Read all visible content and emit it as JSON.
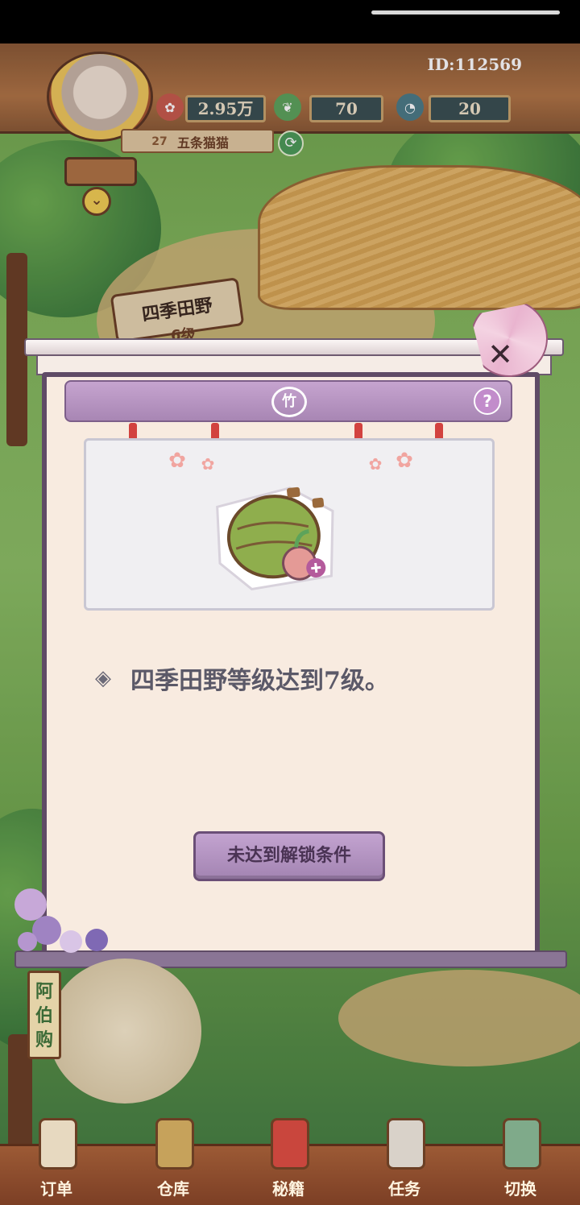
{
  "hud": {
    "user_id": "ID:112569",
    "stats": [
      {
        "name": "coins",
        "value": "2.95万",
        "icon": "coin-icon",
        "color": "#c85a4a"
      },
      {
        "name": "leaves",
        "value": "70",
        "icon": "leaf-icon",
        "color": "#5da35a"
      },
      {
        "name": "stamina",
        "value": "20",
        "icon": "stamina-icon",
        "color": "#4c7c86"
      }
    ],
    "player": {
      "level": "27",
      "name": "五条猫猫"
    }
  },
  "scene": {
    "field_sign": "四季田野",
    "field_sign_level": "6级"
  },
  "modal": {
    "header_icon": "竹",
    "help_label": "?",
    "close_label": "✕",
    "condition_text": "四季田野等级达到7级。",
    "unlock_button_label": "未达到解锁条件"
  },
  "shop_sign": "阿伯购",
  "bottom_nav": [
    {
      "label": "订单",
      "icon": "order-icon",
      "color": "#e7d9c0"
    },
    {
      "label": "仓库",
      "icon": "warehouse-icon",
      "color": "#c6a25b"
    },
    {
      "label": "秘籍",
      "icon": "book-icon",
      "color": "#c9463d"
    },
    {
      "label": "任务",
      "icon": "task-icon",
      "color": "#d9d2c9"
    },
    {
      "label": "切换",
      "icon": "map-icon",
      "color": "#7faa8a"
    }
  ]
}
